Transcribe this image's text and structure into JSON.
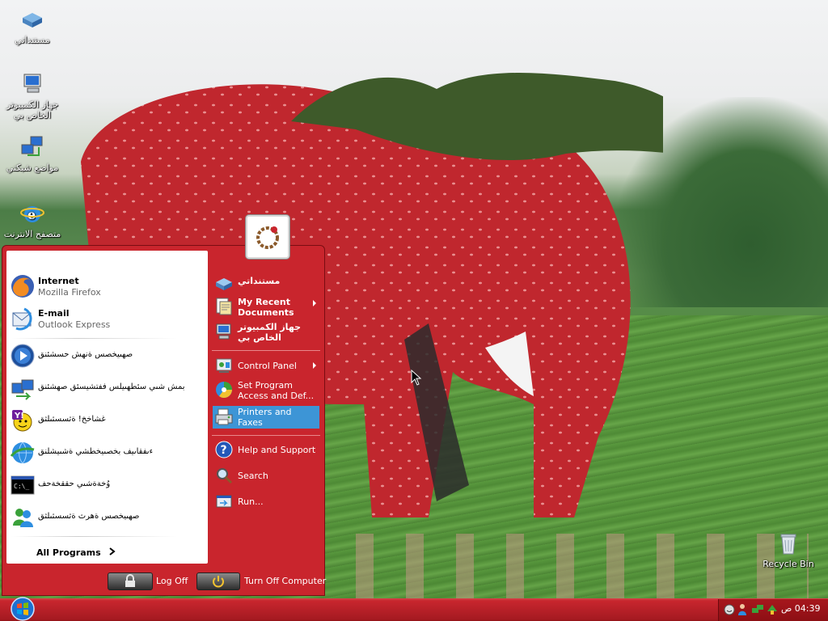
{
  "desktop": {
    "icons": [
      {
        "label": "مستنداتي",
        "icon": "my-documents-icon"
      },
      {
        "label": "جهاز الكمبيوتر الخاص بي",
        "icon": "my-computer-icon"
      },
      {
        "label": "مواضع شبكتي",
        "icon": "network-places-icon"
      },
      {
        "label": "متصفح الانترنت",
        "icon": "internet-explorer-icon"
      },
      {
        "label": "Recycle Bin",
        "icon": "recycle-bin-icon"
      }
    ]
  },
  "start_menu": {
    "pinned": [
      {
        "title": "Internet",
        "subtitle": "Mozilla Firefox",
        "icon": "firefox-icon"
      },
      {
        "title": "E-mail",
        "subtitle": "Outlook Express",
        "icon": "outlook-express-icon"
      }
    ],
    "recent": [
      {
        "label": "صهىيخصس ةنهش حسشئنق",
        "icon": "media-player-icon"
      },
      {
        "label": "بمش شىي سئطهىيلس ففتشيسئق صهشئنق",
        "icon": "files-transfer-icon"
      },
      {
        "label": "غشاخخ! ةثسسثىلثق",
        "icon": "yahoo-messenger-icon"
      },
      {
        "label": "ءىفقاىيف بخصىيخطشي ةشىيشلنق",
        "icon": "windows-messenger-icon"
      },
      {
        "label": "وُخةةشىي حققخةحف",
        "icon": "command-prompt-icon"
      },
      {
        "label": "صهىيخصس ةهرث ةثسسثىلثق",
        "icon": "msn-messenger-icon"
      }
    ],
    "all_programs": "All Programs",
    "right": [
      {
        "label": "مستنداتي",
        "icon": "my-documents-icon",
        "bold": true,
        "submenu": false
      },
      {
        "label": "My Recent Documents",
        "icon": "recent-documents-icon",
        "bold": true,
        "submenu": true
      },
      {
        "label": "جهاز الكمبيوتر الخاص بي",
        "icon": "my-computer-icon",
        "bold": true,
        "submenu": false
      },
      {
        "label": "Control Panel",
        "icon": "control-panel-icon",
        "bold": false,
        "submenu": true
      },
      {
        "label": "Set Program Access and Def...",
        "icon": "set-program-access-icon",
        "bold": false,
        "submenu": false
      },
      {
        "label": "Printers and Faxes",
        "icon": "printers-faxes-icon",
        "bold": false,
        "submenu": false,
        "highlighted": true
      },
      {
        "label": "Help and Support",
        "icon": "help-icon",
        "bold": false,
        "submenu": false
      },
      {
        "label": "Search",
        "icon": "search-icon",
        "bold": false,
        "submenu": false
      },
      {
        "label": "Run...",
        "icon": "run-icon",
        "bold": false,
        "submenu": false
      }
    ],
    "log_off": "Log Off",
    "turn_off": "Turn Off Computer"
  },
  "taskbar": {
    "clock": "04:39 ص",
    "accent": "#c8262e"
  }
}
